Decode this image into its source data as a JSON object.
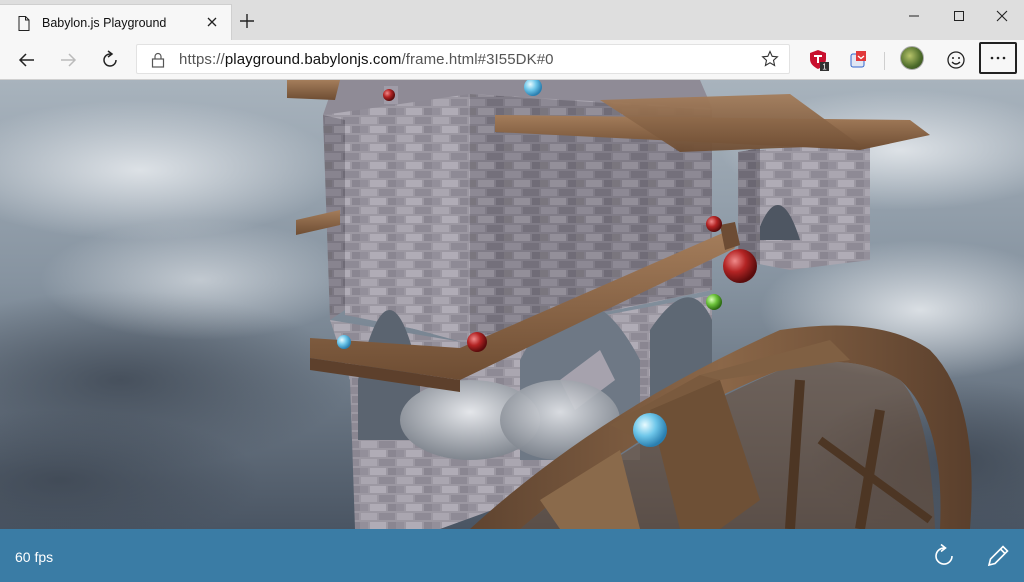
{
  "tab": {
    "title": "Babylon.js Playground"
  },
  "address_bar": {
    "scheme": "https://",
    "host": "playground.babylonjs.com",
    "path": "/frame.html#3I55DK#0"
  },
  "extensions": {
    "badge_count": "1"
  },
  "status": {
    "fps_label": "60 fps"
  },
  "colors": {
    "status_bar": "#3a7ca5",
    "title_bar": "#dedede",
    "toolbar": "#f7f7f7"
  },
  "icons": {
    "tab": "page-icon",
    "close": "close-icon",
    "new_tab": "plus-icon",
    "minimize": "minimize-icon",
    "maximize": "maximize-icon",
    "window_close": "window-close-icon",
    "back": "back-arrow-icon",
    "forward": "forward-arrow-icon",
    "refresh": "refresh-icon",
    "lock": "lock-icon",
    "favorite": "star-icon",
    "emoji": "smiley-icon",
    "more": "ellipsis-icon",
    "restart": "restart-icon",
    "edit": "pencil-icon"
  }
}
